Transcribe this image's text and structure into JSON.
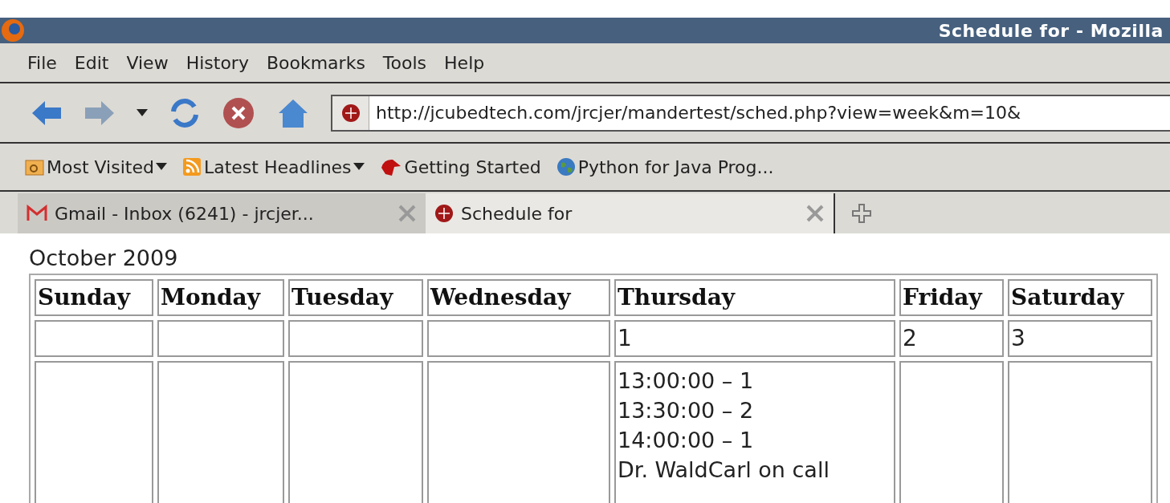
{
  "window": {
    "title": "Schedule for - Mozilla"
  },
  "menu": [
    "File",
    "Edit",
    "View",
    "History",
    "Bookmarks",
    "Tools",
    "Help"
  ],
  "address_bar": {
    "value": "http://jcubedtech.com/jrcjer/mandertest/sched.php?view=week&m=10&"
  },
  "bookmarks": [
    {
      "label": "Most Visited",
      "kind": "folder",
      "dropdown": true
    },
    {
      "label": "Latest Headlines",
      "kind": "feed",
      "dropdown": true
    },
    {
      "label": "Getting Started",
      "kind": "mascot",
      "dropdown": false
    },
    {
      "label": "Python for Java Prog...",
      "kind": "globe",
      "dropdown": false
    }
  ],
  "tabs": [
    {
      "label": "Gmail - Inbox (6241) - jrcjer...",
      "kind": "mail",
      "selected": false
    },
    {
      "label": "Schedule for",
      "kind": "site",
      "selected": true
    }
  ],
  "page": {
    "heading": "October 2009",
    "days": [
      {
        "name": "Sunday"
      },
      {
        "name": "Monday"
      },
      {
        "name": "Tuesday"
      },
      {
        "name": "Wednesday"
      },
      {
        "name": "Thursday",
        "date": "1",
        "events": [
          "13:00:00 – 1",
          "13:30:00 – 2",
          "14:00:00 – 1",
          "Dr. WaldCarl on call"
        ]
      },
      {
        "name": "Friday",
        "date": "2"
      },
      {
        "name": "Saturday",
        "date": "3"
      }
    ]
  }
}
